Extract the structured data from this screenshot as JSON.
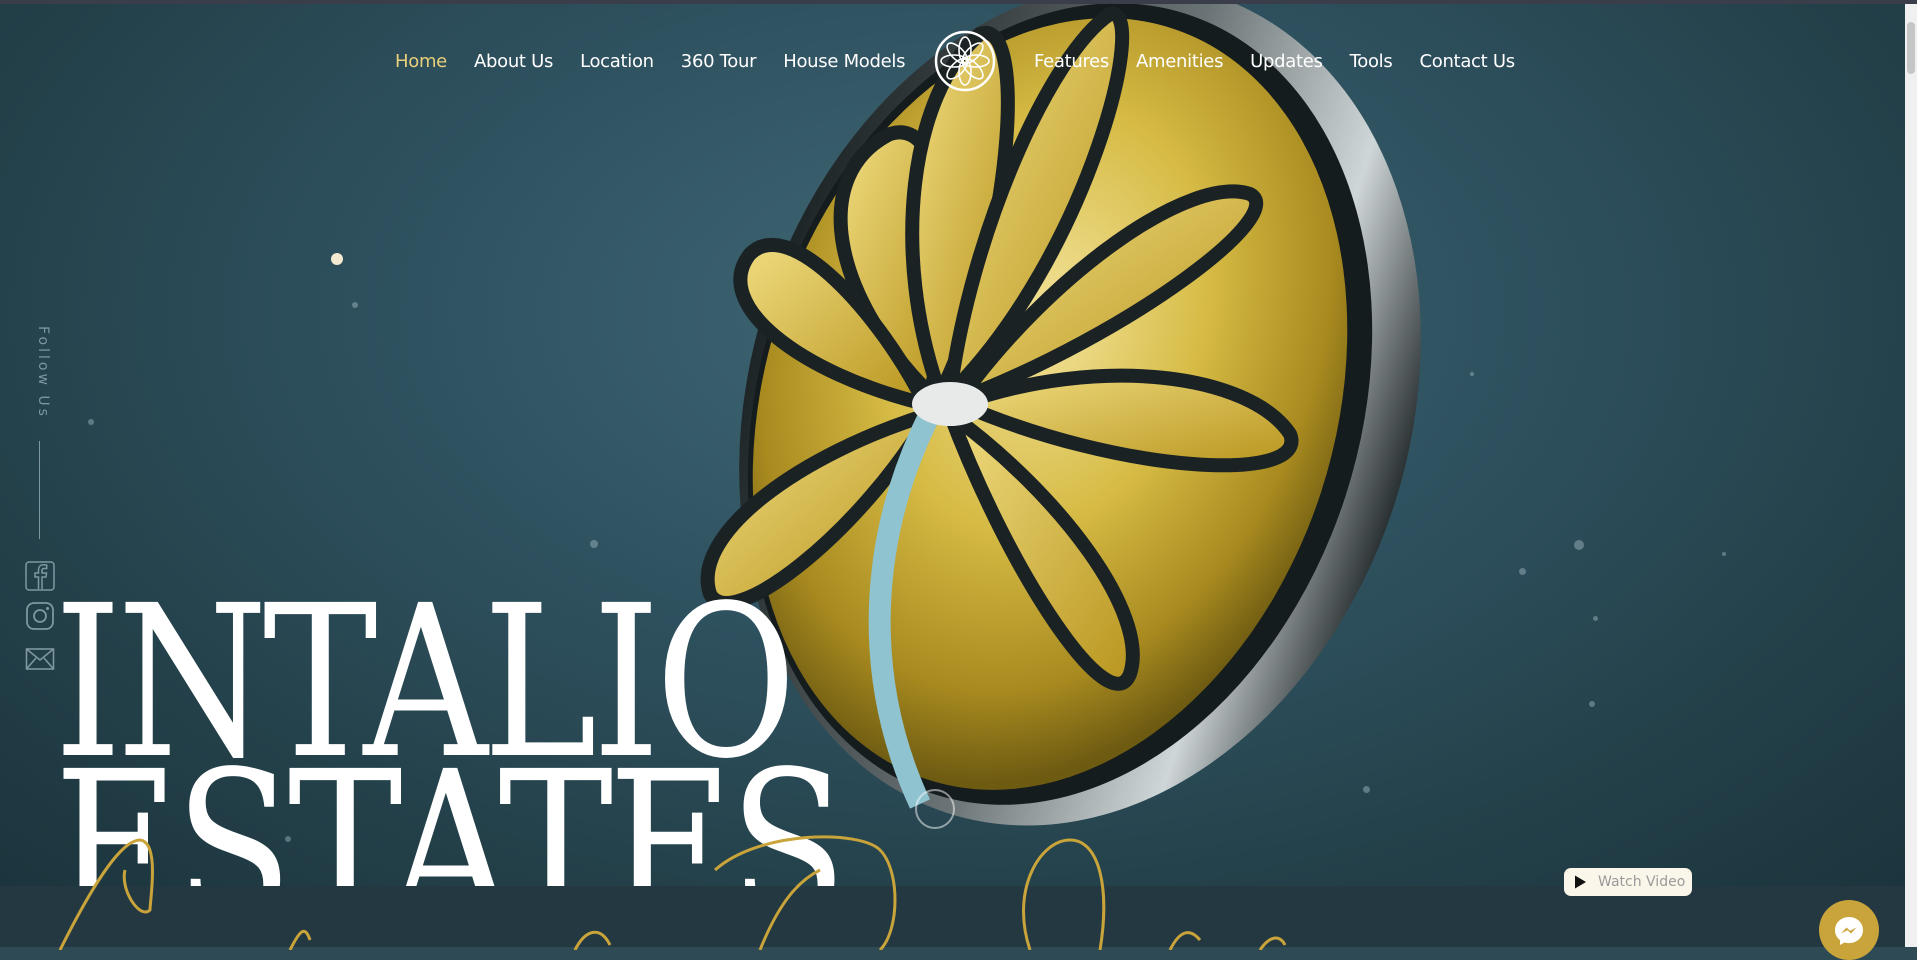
{
  "nav": {
    "left": [
      {
        "label": "Home",
        "active": true
      },
      {
        "label": "About Us"
      },
      {
        "label": "Location"
      },
      {
        "label": "360 Tour"
      },
      {
        "label": "House Models"
      }
    ],
    "right": [
      {
        "label": "Features"
      },
      {
        "label": "Amenities"
      },
      {
        "label": "Updates"
      },
      {
        "label": "Tools"
      },
      {
        "label": "Contact Us"
      }
    ]
  },
  "social": {
    "follow_label": "Follow Us",
    "icons": [
      "facebook-icon",
      "instagram-icon",
      "mail-icon"
    ]
  },
  "hero": {
    "title_line1": "INTALIO",
    "title_line2": "ESTATES"
  },
  "watch_video": {
    "label": "Watch Video"
  },
  "colors": {
    "accent_gold": "#e9d07a",
    "background": "#2d4a55",
    "medallion_gold": "#c9a43a"
  }
}
